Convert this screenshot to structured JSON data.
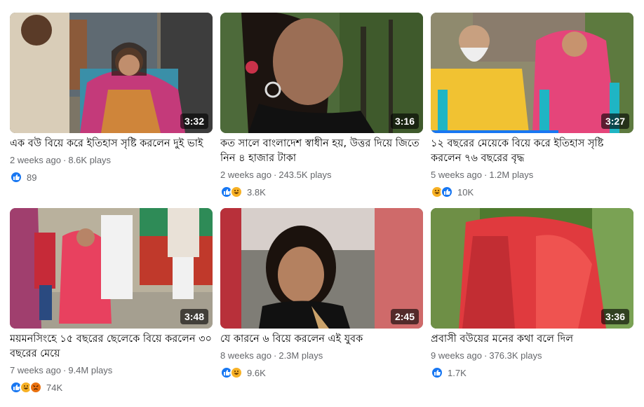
{
  "videos": [
    {
      "title": "এক বউ বিয়ে করে ইতিহাস সৃষ্টি করলেন দুই ভাই",
      "duration": "3:32",
      "age": "2 weeks ago",
      "plays": "8.6K plays",
      "reactions": [
        "like-icon"
      ],
      "reaction_count": "89",
      "progress": 0
    },
    {
      "title": "কত সালে বাংলাদেশ স্বাধীন হয়, উত্তর দিয়ে জিতে নিন ৪ হাজার টাকা",
      "duration": "3:16",
      "age": "2 weeks ago",
      "plays": "243.5K plays",
      "reactions": [
        "like-icon",
        "haha-icon"
      ],
      "reaction_count": "3.8K",
      "progress": 0
    },
    {
      "title": "১২ বছরের মেয়েকে বিয়ে করে ইতিহাস সৃষ্টি করলেন ৭৬ বছরের বৃদ্ধ",
      "duration": "3:27",
      "age": "5 weeks ago",
      "plays": "1.2M plays",
      "reactions": [
        "haha-icon",
        "like-icon"
      ],
      "reaction_count": "10K",
      "progress": 0.63
    },
    {
      "title": "ময়মনসিংহে ১৫ বছরের ছেলেকে বিয়ে করলেন ৩০ বছরের মেয়ে",
      "duration": "3:48",
      "age": "7 weeks ago",
      "plays": "9.4M plays",
      "reactions": [
        "like-icon",
        "haha-icon",
        "angry-icon"
      ],
      "reaction_count": "74K",
      "progress": 0
    },
    {
      "title": "যে কারনে ৬ বিয়ে করলেন এই যুবক",
      "duration": "2:45",
      "age": "8 weeks ago",
      "plays": "2.3M plays",
      "reactions": [
        "like-icon",
        "haha-icon"
      ],
      "reaction_count": "9.6K",
      "progress": 0
    },
    {
      "title": "প্রবাসী বউয়ের মনের কথা বলে দিল",
      "duration": "3:36",
      "age": "9 weeks ago",
      "plays": "376.3K plays",
      "reactions": [
        "like-icon"
      ],
      "reaction_count": "1.7K",
      "progress": 0
    }
  ],
  "colors": {
    "accent": "#1877f2",
    "like": "#1877f2",
    "haha": "#f7b125",
    "angry": "#e9710f",
    "meta": "#65676b"
  }
}
